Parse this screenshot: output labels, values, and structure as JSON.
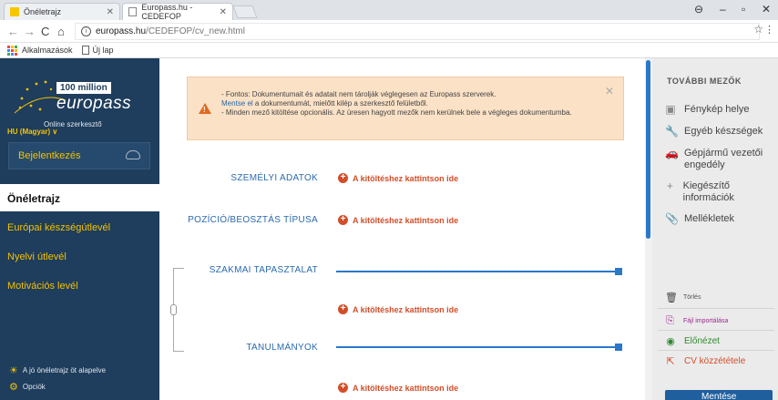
{
  "browser": {
    "tabs": [
      {
        "title": "Önéletrajz",
        "active": false
      },
      {
        "title": "Europass.hu - CEDEFOP",
        "active": true
      }
    ],
    "url_host": "europass.hu",
    "url_path": "/CEDEFOP/cv_new.html",
    "bookmarks": [
      "Alkalmazások",
      "Új lap"
    ]
  },
  "sidebar": {
    "logo_million": "100 million",
    "logo_brand": "europass",
    "logo_tagline": "Online szerkesztő",
    "language": "HU (Magyar)",
    "login_label": "Bejelentkezés",
    "active_item": "Önéletrajz",
    "items": [
      "Európai készségútlevél",
      "Nyelvi útlevél",
      "Motivációs levél"
    ],
    "footer": [
      "A jó önéletrajz öt alapelve",
      "Opciók"
    ]
  },
  "alert": {
    "line1": "- Fontos: Dokumentumait és adatait nem tárolják véglegesen az Europass szerverek.",
    "link": "Mentse el",
    "line2_rest": " a dokumentumát, mielőtt kilép a szerkesztő felületből.",
    "line3": "- Minden mező kitöltése opcionális. Az üresen hagyott mezők nem kerülnek bele a végleges dokumentumba."
  },
  "sections": [
    {
      "label": "SZEMÉLYI ADATOK",
      "action": "A kitöltéshez kattintson ide"
    },
    {
      "label": "POZÍCIÓ/BEOSZTÁS TÍPUSA",
      "action": "A kitöltéshez kattintson ide"
    },
    {
      "label": "SZAKMAI TAPASZTALAT",
      "action": "A kitöltéshez kattintson ide"
    },
    {
      "label": "TANULMÁNYOK",
      "action": "A kitöltéshez kattintson ide"
    }
  ],
  "right_panel": {
    "title": "TOVÁBBI MEZŐK",
    "items": [
      {
        "label": "Fénykép helye",
        "icon": "photo-icon"
      },
      {
        "label": "Egyéb készségek",
        "icon": "wrench-icon"
      },
      {
        "label": "Gépjármű vezetői engedély",
        "icon": "car-icon"
      },
      {
        "label": "Kiegészítő információk",
        "icon": "plus-icon"
      },
      {
        "label": "Mellékletek",
        "icon": "paperclip-icon"
      }
    ],
    "delete_label": "Törlés",
    "import_label": "Fájl importálása",
    "preview_label": "Előnézet",
    "publish_label": "CV közzététele",
    "save_label": "Mentése"
  },
  "colors": {
    "sidebar_bg": "#1f3d5c",
    "accent_yellow": "#f3c200",
    "section_blue": "#2a6aad",
    "action_red": "#d24e2a",
    "alert_bg": "#fbe1c6"
  }
}
